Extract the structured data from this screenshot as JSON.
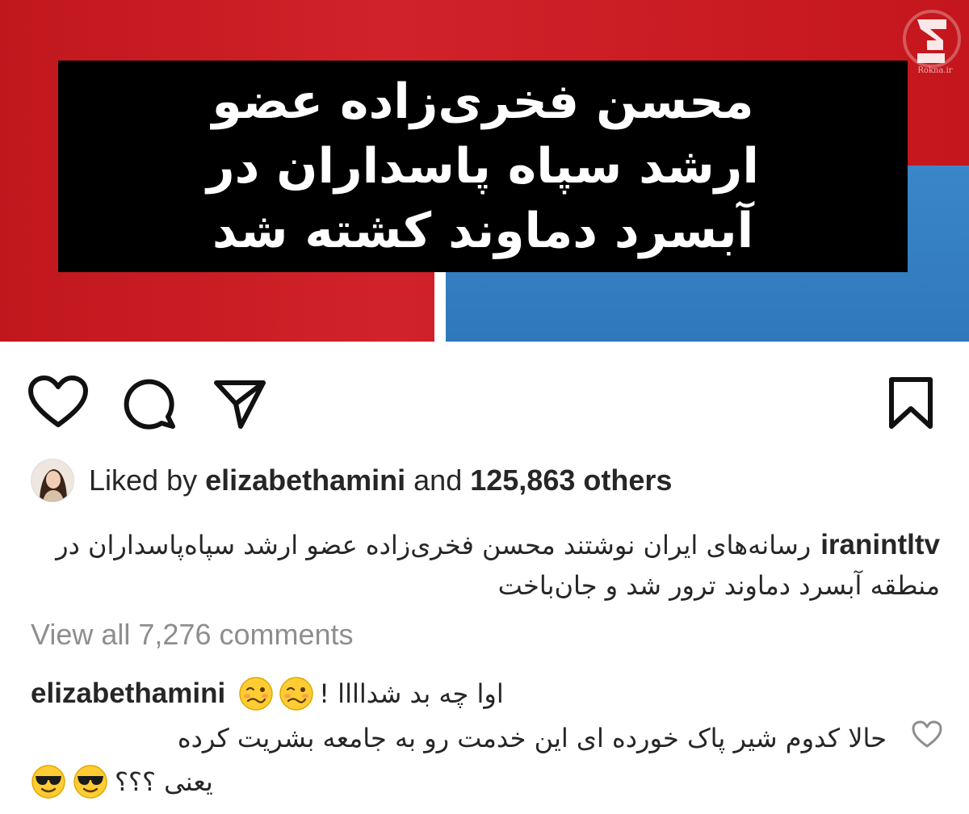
{
  "post_image": {
    "headline": "محسن فخری‌زاده عضو\nارشد سپاه پاسداران در\nآبسرد دماوند کشته شد",
    "logo_caption": "Rokna.ir"
  },
  "actions": {
    "like_icon": "heart-icon",
    "comment_icon": "comment-icon",
    "share_icon": "paper-plane-icon",
    "save_icon": "bookmark-icon"
  },
  "likes": {
    "prefix": "Liked by ",
    "user": "elizabethamini",
    "middle": " and ",
    "count": "125,863 others"
  },
  "caption": {
    "username": "iranintltv",
    "text": "رسانه‌های ایران نوشتند محسن فخری‌زاده عضو ارشد سپاه‌پاسداران در منطقه آبسرد دماوند ترور شد و جان‌باخت"
  },
  "view_all_comments": "View all 7,276 comments",
  "comment": {
    "username": "elizabethamini",
    "head_text": "اوا چه بد شداااا !",
    "body_text": "حالا کدوم شیر پاک خورده ای این خدمت رو به جامعه بشریت کرده",
    "tail_text": "یعنی ؟؟؟",
    "emoji_woozy": "woozy-face-emoji",
    "emoji_sunglasses": "sunglasses-face-emoji"
  },
  "colors": {
    "red": "#c4161c",
    "blue": "#2f78bb",
    "black": "#000000",
    "text": "#262626",
    "muted": "#8e8e8e"
  }
}
